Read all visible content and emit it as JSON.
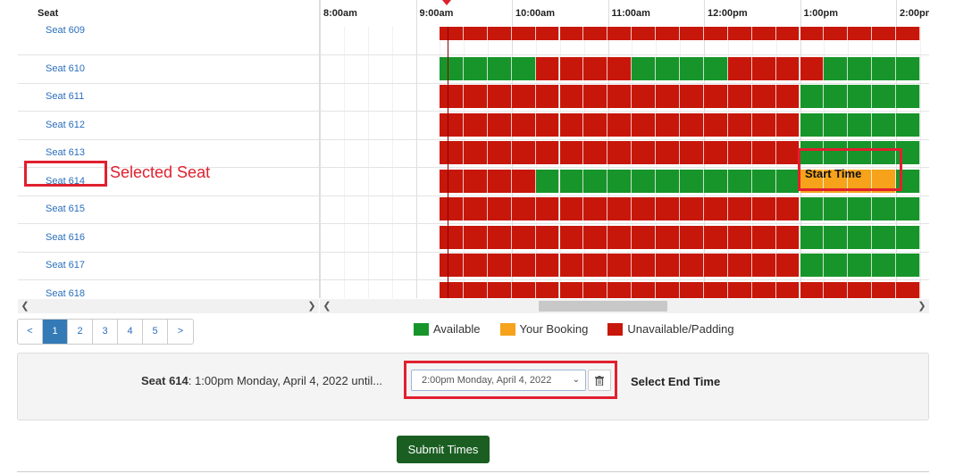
{
  "seat_column_header": "Seat",
  "hours": [
    "8:00am",
    "9:00am",
    "10:00am",
    "11:00am",
    "12:00pm",
    "1:00pm",
    "2:00pm"
  ],
  "seats": [
    {
      "label": "Seat 609",
      "segments": [
        [
          "unavailable",
          20
        ]
      ]
    },
    {
      "label": "Seat 610",
      "segments": [
        [
          "available",
          4
        ],
        [
          "unavailable",
          4
        ],
        [
          "available",
          4
        ],
        [
          "unavailable",
          4
        ],
        [
          "available",
          4
        ]
      ]
    },
    {
      "label": "Seat 611",
      "segments": [
        [
          "unavailable",
          15
        ],
        [
          "available",
          5
        ]
      ]
    },
    {
      "label": "Seat 612",
      "segments": [
        [
          "unavailable",
          15
        ],
        [
          "available",
          5
        ]
      ]
    },
    {
      "label": "Seat 613",
      "segments": [
        [
          "unavailable",
          15
        ],
        [
          "available",
          5
        ]
      ]
    },
    {
      "label": "Seat 614",
      "segments": [
        [
          "unavailable",
          4
        ],
        [
          "available",
          11
        ],
        [
          "booking",
          4
        ],
        [
          "available",
          1
        ]
      ]
    },
    {
      "label": "Seat 615",
      "segments": [
        [
          "unavailable",
          15
        ],
        [
          "available",
          5
        ]
      ]
    },
    {
      "label": "Seat 616",
      "segments": [
        [
          "unavailable",
          15
        ],
        [
          "available",
          5
        ]
      ]
    },
    {
      "label": "Seat 617",
      "segments": [
        [
          "unavailable",
          15
        ],
        [
          "available",
          5
        ]
      ]
    },
    {
      "label": "Seat 618",
      "segments": [
        [
          "unavailable",
          20
        ]
      ]
    }
  ],
  "pagination": {
    "prev": "<",
    "pages": [
      "1",
      "2",
      "3",
      "4",
      "5"
    ],
    "next": ">",
    "current": "1"
  },
  "legend": [
    {
      "label": "Available",
      "color": "#17952a"
    },
    {
      "label": "Your Booking",
      "color": "#f6a21a"
    },
    {
      "label": "Unavailable/Padding",
      "color": "#c7170a"
    }
  ],
  "selection": {
    "seat": "Seat 614",
    "summary": ": 1:00pm Monday, April 4, 2022 until...",
    "end_time_value": "2:00pm Monday, April 4, 2022"
  },
  "annotations": {
    "selected_seat": "Selected Seat",
    "start_time": "Start Time",
    "select_end_time": "Select End Time"
  },
  "submit_label": "Submit Times",
  "colors": {
    "available": "#17952a",
    "booking": "#f6a21a",
    "unavailable": "#c7170a",
    "accent": "#337ab7",
    "annotation": "#e0202f"
  }
}
